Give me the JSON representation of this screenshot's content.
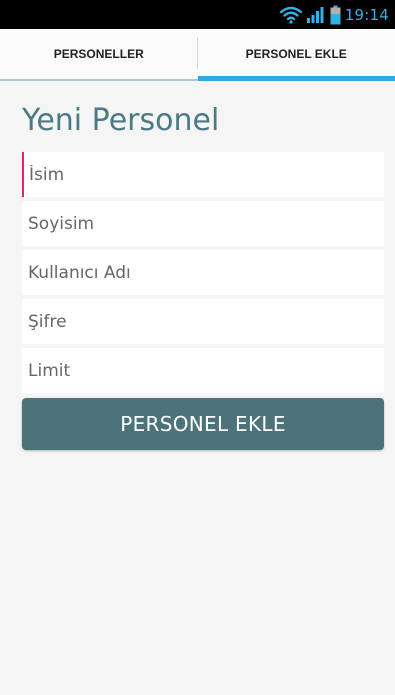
{
  "status_bar": {
    "time": "19:14",
    "wifi_icon": "wifi-icon",
    "signal_icon": "signal-icon",
    "battery_icon": "battery-icon",
    "accent_color": "#31b2e6"
  },
  "tabs": [
    {
      "label": "PERSONELLER",
      "active": false
    },
    {
      "label": "PERSONEL EKLE",
      "active": true
    }
  ],
  "form": {
    "title": "Yeni Personel",
    "fields": [
      {
        "placeholder": "İsim",
        "value": "",
        "focused": true
      },
      {
        "placeholder": "Soyisim",
        "value": "",
        "focused": false
      },
      {
        "placeholder": "Kullanıcı Adı",
        "value": "",
        "focused": false
      },
      {
        "placeholder": "Şifre",
        "value": "",
        "focused": false
      },
      {
        "placeholder": "Limit",
        "value": "",
        "focused": false
      }
    ],
    "submit_label": "PERSONEL EKLE"
  },
  "colors": {
    "title": "#4a7a84",
    "button": "#4c727a",
    "active_tab_indicator": "#2fa9de",
    "cursor": "#e3227a"
  }
}
